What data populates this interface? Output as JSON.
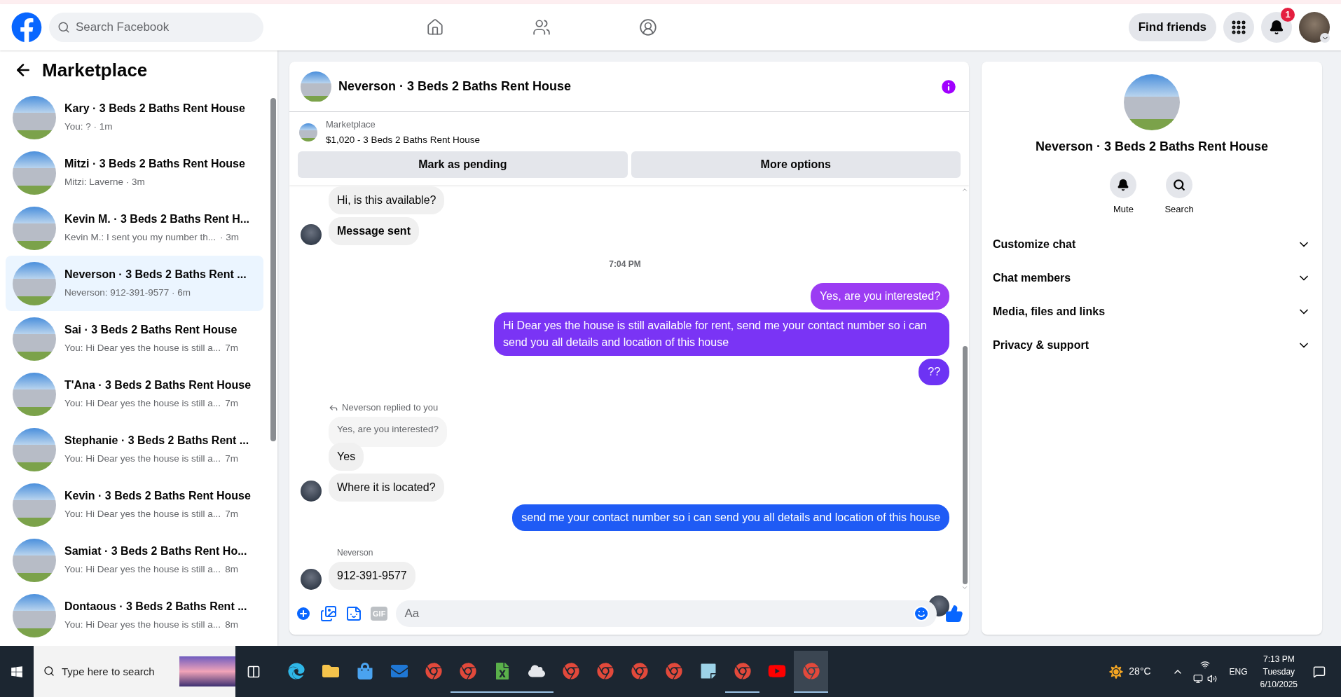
{
  "topbar": {
    "search_placeholder": "Search Facebook",
    "nav": [
      {
        "kind": "home",
        "selected": false
      },
      {
        "kind": "friends",
        "selected": false
      },
      {
        "kind": "groups",
        "selected": false
      }
    ],
    "find_friends": "Find friends",
    "notification_count": "1"
  },
  "sidebar": {
    "title": "Marketplace",
    "chats": [
      {
        "title": "Kary · 3 Beds 2 Baths Rent House",
        "preview": "You: ? · 1m",
        "selected": false
      },
      {
        "title": "Mitzi · 3 Beds 2 Baths Rent House",
        "preview": "Mitzi: Laverne · 3m",
        "selected": false
      },
      {
        "title": "Kevin M. · 3 Beds 2 Baths Rent H...",
        "preview": "Kevin M.: I sent you my number th...",
        "time": "· 3m",
        "selected": false
      },
      {
        "title": "Neverson · 3 Beds 2 Baths Rent ...",
        "preview": "Neverson: 912-391-9577 · 6m",
        "selected": true
      },
      {
        "title": "Sai · 3 Beds 2 Baths Rent House",
        "preview": "You: Hi Dear yes the house is still a...",
        "time": "7m",
        "selected": false
      },
      {
        "title": "T'Ana · 3 Beds 2 Baths Rent House",
        "preview": "You: Hi Dear yes the house is still a...",
        "time": "7m",
        "selected": false
      },
      {
        "title": "Stephanie · 3 Beds 2 Baths Rent ...",
        "preview": "You: Hi Dear yes the house is still a...",
        "time": "7m",
        "selected": false
      },
      {
        "title": "Kevin · 3 Beds 2 Baths Rent House",
        "preview": "You: Hi Dear yes the house is still a...",
        "time": "7m",
        "selected": false
      },
      {
        "title": "Samiat · 3 Beds 2 Baths Rent Ho...",
        "preview": "You: Hi Dear yes the house is still a...",
        "time": "8m",
        "selected": false
      },
      {
        "title": "Dontaous · 3 Beds 2 Baths Rent ...",
        "preview": "You: Hi Dear yes the house is still a...",
        "time": "8m",
        "selected": false
      }
    ]
  },
  "chat": {
    "title": "Neverson · 3 Beds 2 Baths Rent House",
    "listing": {
      "source": "Marketplace",
      "text": "$1,020 - 3 Beds 2 Baths Rent House"
    },
    "actions": [
      "Mark as pending",
      "More options"
    ],
    "messages": [
      {
        "kind": "incoming",
        "text": "Hi, is this available?",
        "avatar": false,
        "bold": false
      },
      {
        "kind": "incoming",
        "text": "Message sent",
        "avatar": true,
        "bold": true
      },
      {
        "kind": "time",
        "text": "7:04 PM"
      },
      {
        "kind": "outgoing",
        "text": "Yes, are you interested?",
        "color": "#9b3cf3"
      },
      {
        "kind": "outgoing",
        "text": "Hi Dear yes the house is still available for rent, send me your contact number so i can send you all details and location of this house",
        "color": "#7a34f5"
      },
      {
        "kind": "outgoing",
        "text": "??",
        "color": "#6d33f4"
      },
      {
        "kind": "reply_note",
        "text": "Neverson replied to you"
      },
      {
        "kind": "quoted",
        "text": "Yes, are you interested?"
      },
      {
        "kind": "incoming",
        "text": "Yes",
        "avatar": false,
        "bold": false
      },
      {
        "kind": "incoming",
        "text": "Where it is located?",
        "avatar": true,
        "bold": false
      },
      {
        "kind": "outgoing",
        "text": "send me your contact number so i can send you all details and location of this house",
        "color": "#1f5bf5"
      },
      {
        "kind": "sender",
        "text": "Neverson"
      },
      {
        "kind": "incoming",
        "text": "912-391-9577",
        "avatar": true,
        "bold": false
      }
    ],
    "composer": {
      "gif_label": "GIF",
      "placeholder": "Aa"
    }
  },
  "details": {
    "title": "Neverson · 3 Beds 2 Baths Rent House",
    "actions": [
      {
        "kind": "mute",
        "label": "Mute"
      },
      {
        "kind": "search",
        "label": "Search"
      }
    ],
    "sections": [
      {
        "label": "Customize chat",
        "expanded": false
      },
      {
        "label": "Chat members",
        "expanded": false
      },
      {
        "label": "Media, files and links",
        "expanded": false
      },
      {
        "label": "Privacy & support",
        "expanded": false
      }
    ]
  },
  "taskbar": {
    "search_placeholder": "Type here to search",
    "apps": [
      {
        "kind": "edge",
        "running": false,
        "selected": false
      },
      {
        "kind": "folder",
        "running": false,
        "selected": false
      },
      {
        "kind": "store",
        "running": false,
        "selected": false
      },
      {
        "kind": "outlook",
        "running": false,
        "selected": false
      },
      {
        "kind": "chrome",
        "running": false,
        "selected": false
      },
      {
        "kind": "chrome",
        "running": true,
        "selected": false
      },
      {
        "kind": "sheet",
        "running": true,
        "selected": false
      },
      {
        "kind": "drive",
        "running": true,
        "selected": false
      },
      {
        "kind": "chrome",
        "running": false,
        "selected": false
      },
      {
        "kind": "chrome",
        "running": false,
        "selected": false
      },
      {
        "kind": "chrome",
        "running": false,
        "selected": false
      },
      {
        "kind": "chrome",
        "running": false,
        "selected": false
      },
      {
        "kind": "notes",
        "running": false,
        "selected": false
      },
      {
        "kind": "chrome",
        "running": true,
        "selected": false
      },
      {
        "kind": "youtube",
        "running": false,
        "selected": false
      },
      {
        "kind": "chrome",
        "running": true,
        "selected": true
      }
    ],
    "weather": "28°C",
    "language": "ENG",
    "time": "7:13 PM",
    "day": "Tuesday",
    "date": "6/10/2025"
  }
}
